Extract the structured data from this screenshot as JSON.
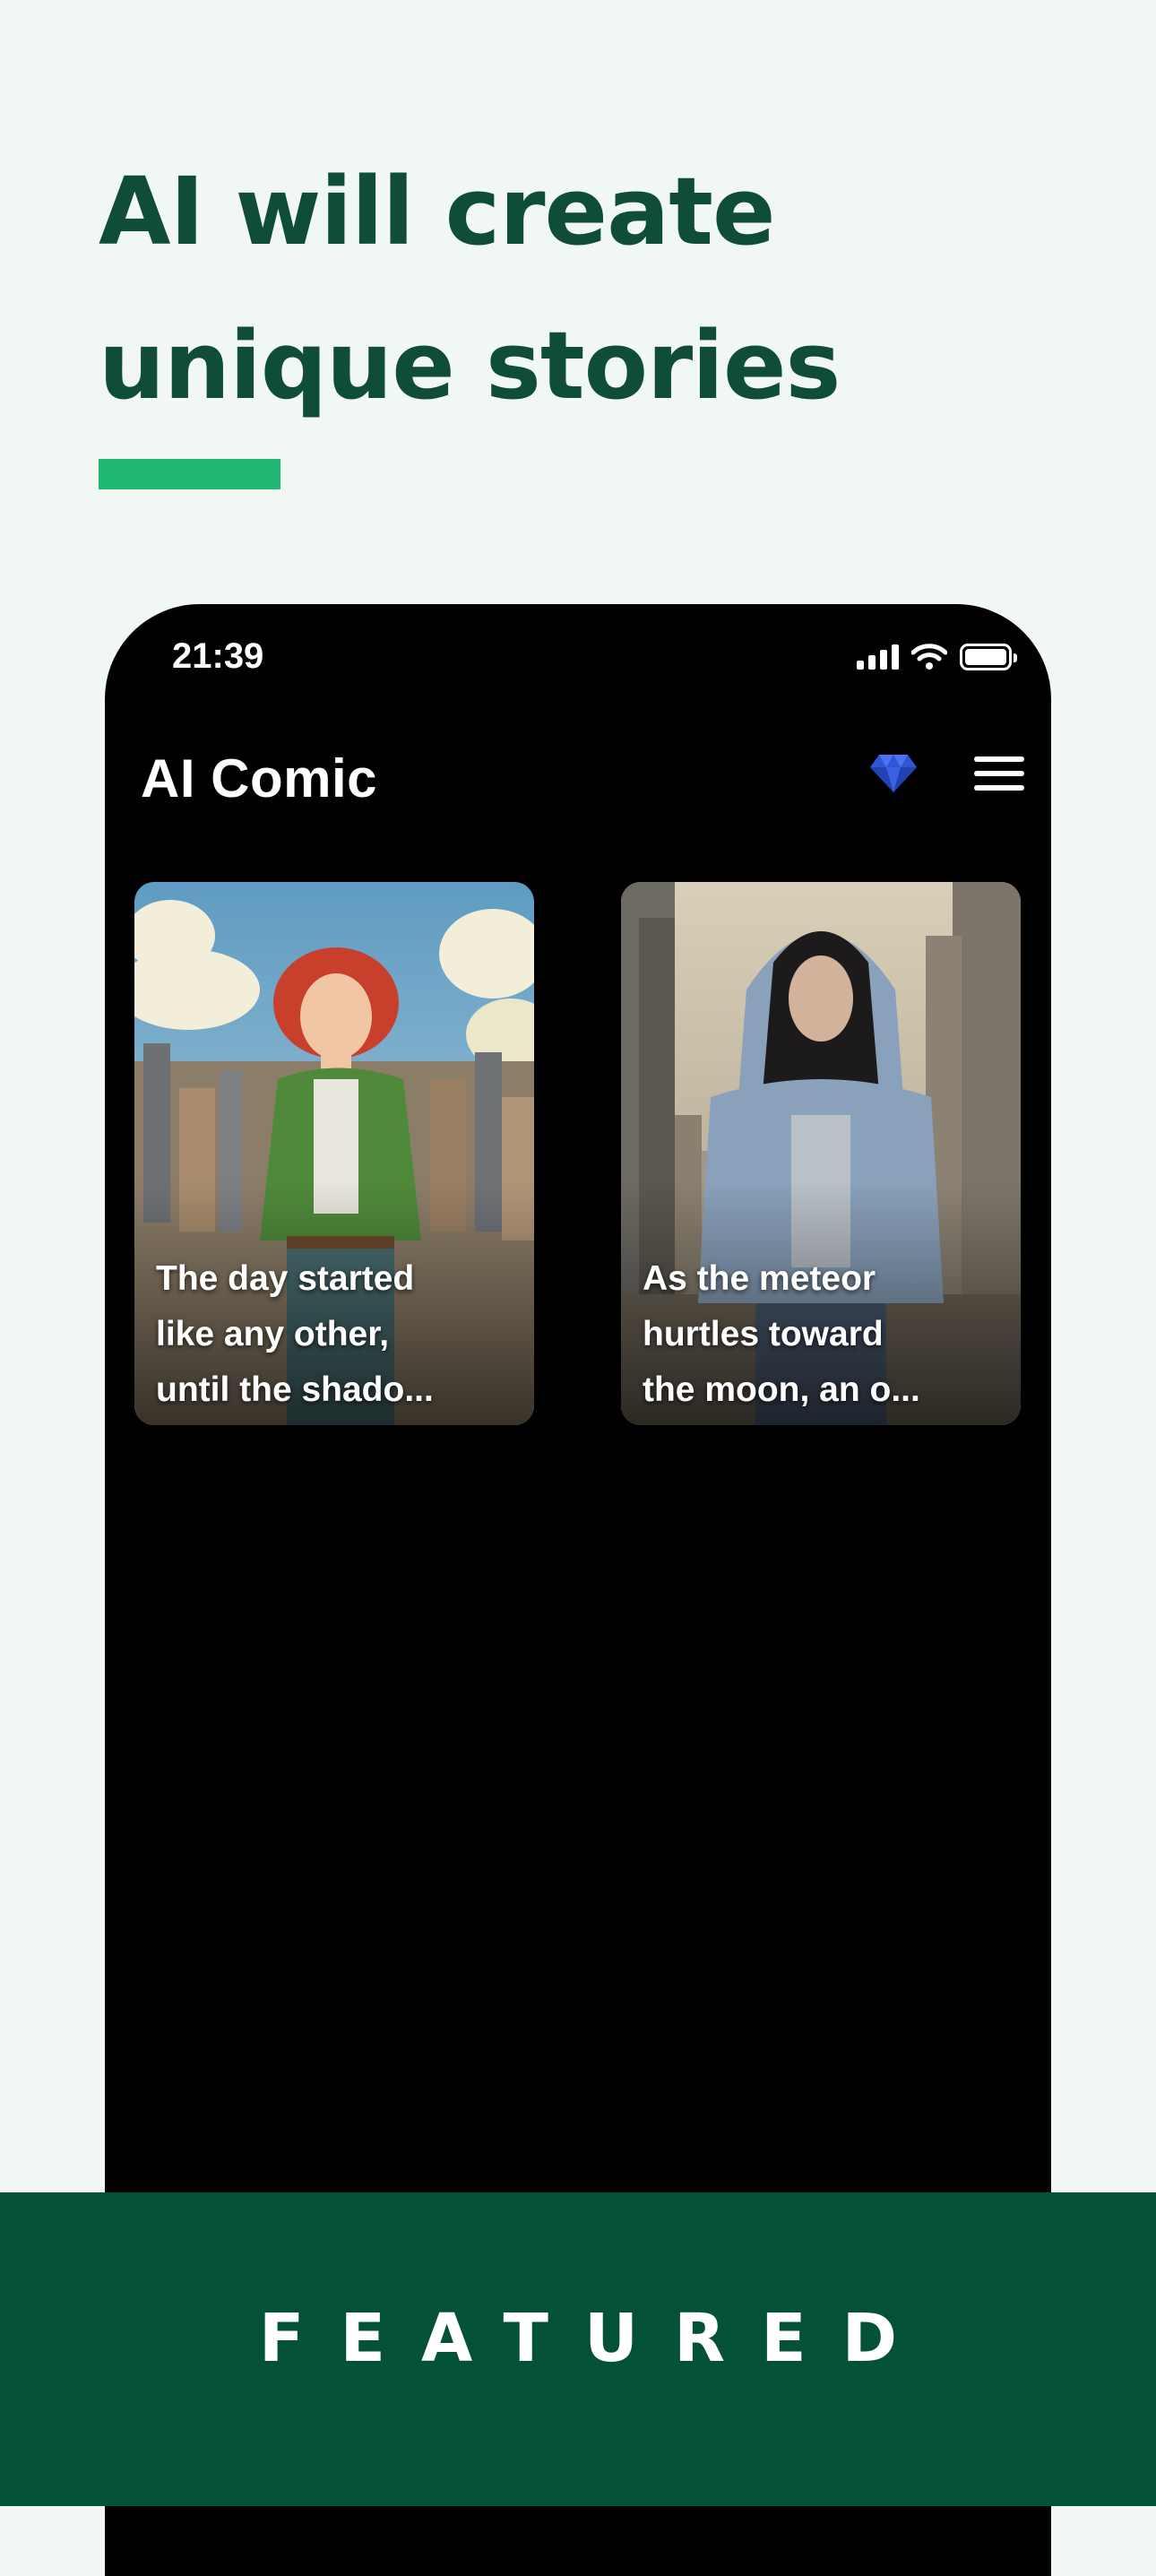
{
  "headline": {
    "line1": "AI will create",
    "line2": "unique stories"
  },
  "phone": {
    "status": {
      "time": "21:39"
    },
    "app": {
      "title": "AI Comic"
    },
    "stories": [
      {
        "caption": "The day started\nlike any other,\nuntil the shado..."
      },
      {
        "caption": "As the meteor\nhurtles toward\nthe moon, an o..."
      }
    ]
  },
  "banner": {
    "text": "FEATURED"
  },
  "colors": {
    "background": "#f1f7f2",
    "headline": "#0f4d38",
    "accent": "#20b874",
    "banner": "#035237",
    "diamond": "#2f55d4"
  }
}
